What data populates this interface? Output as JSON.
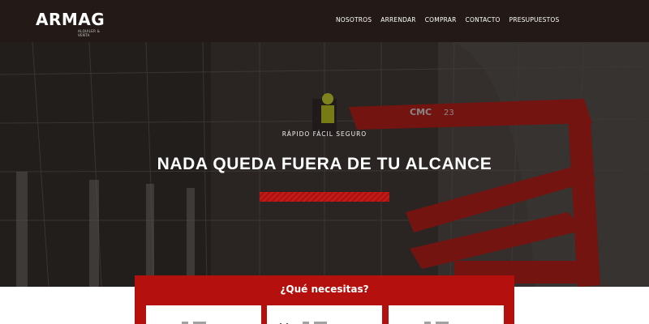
{
  "brand": {
    "name": "ARMAG",
    "tagline": "ALQUILER & VENTA"
  },
  "nav": {
    "items": [
      "NOSOTROS",
      "ARRENDAR",
      "COMPRAR",
      "CONTACTO",
      "PRESUPUESTOS"
    ]
  },
  "hero": {
    "kicker": "RÁPIDO FÁCIL SEGURO",
    "title": "NADA QUEDA FUERA DE TU ALCANCE",
    "lift_brand": "CMC",
    "lift_model": "23"
  },
  "panel": {
    "title": "¿Qué necesitas?",
    "cards": [
      {
        "icon": "truck-icon"
      },
      {
        "icon": "calendar-icon"
      },
      {
        "icon": "clipboard-icon"
      }
    ]
  },
  "colors": {
    "header_bg": "#231a17",
    "accent_red": "#b4100e",
    "text_white": "#ffffff"
  }
}
